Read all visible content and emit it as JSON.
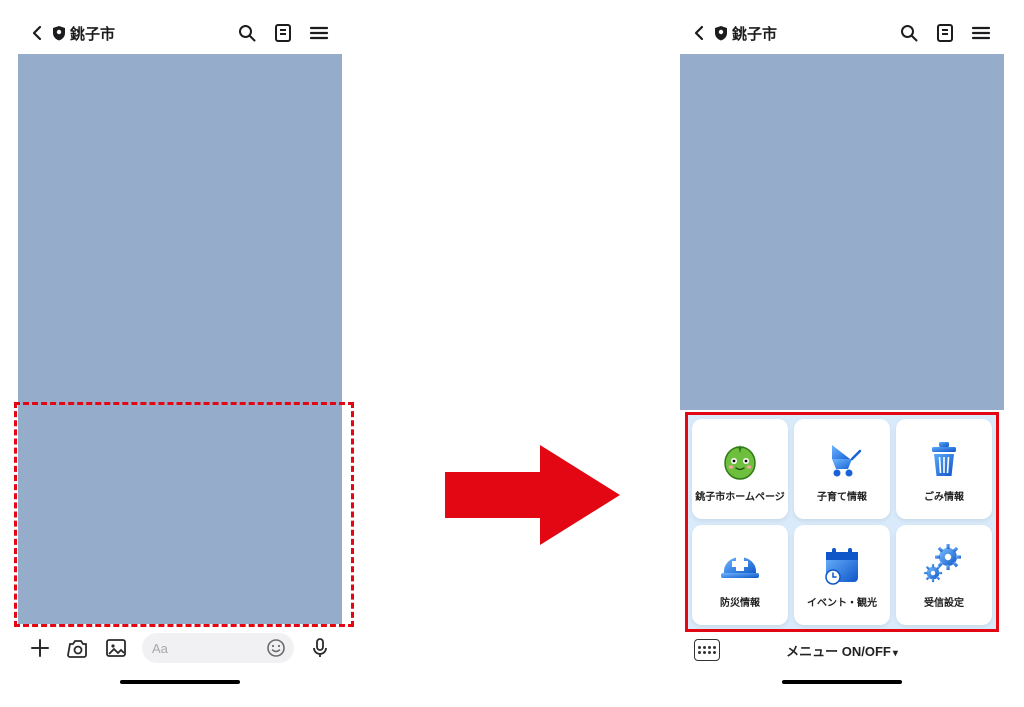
{
  "header": {
    "title": "銚子市"
  },
  "input": {
    "placeholder": "Aa"
  },
  "menu_toggle": {
    "label": "メニュー ON/OFF",
    "caret": "▾"
  },
  "menu_tiles": [
    {
      "id": "homepage",
      "label": "銚子市ホームページ"
    },
    {
      "id": "childcare",
      "label": "子育て情報"
    },
    {
      "id": "garbage",
      "label": "ごみ情報"
    },
    {
      "id": "disaster",
      "label": "防災情報"
    },
    {
      "id": "events",
      "label": "イベント・観光"
    },
    {
      "id": "settings",
      "label": "受信設定"
    }
  ]
}
